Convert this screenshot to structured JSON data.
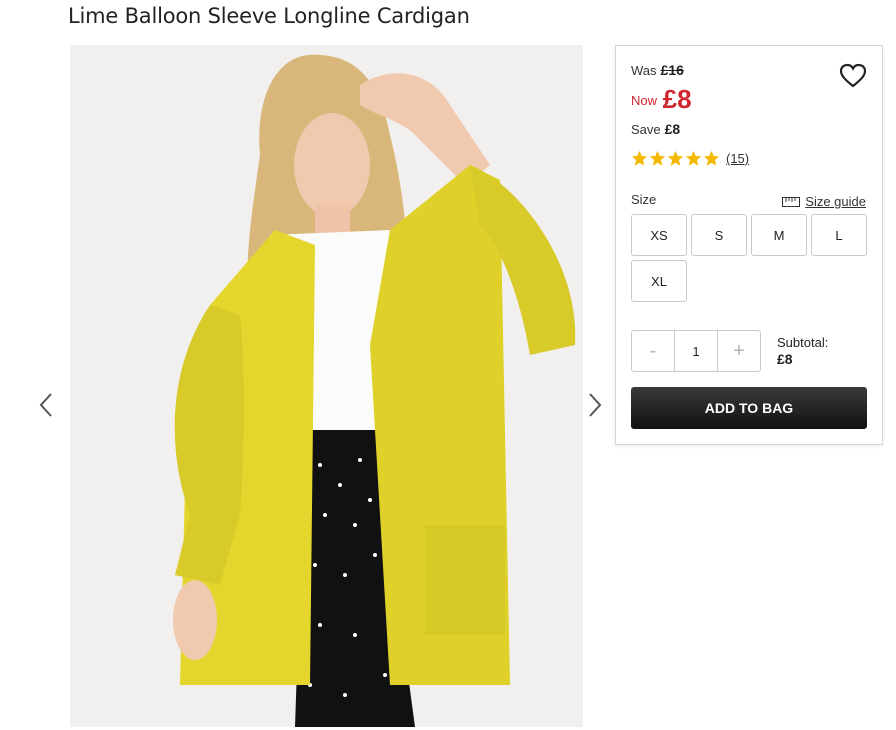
{
  "product": {
    "title": "Lime Balloon Sleeve Longline Cardigan"
  },
  "gallery": {
    "image_desc": "product-photo",
    "prev_icon": "chevron-left-icon",
    "next_icon": "chevron-right-icon",
    "colors": {
      "cardigan": "#e4d62c",
      "skirt": "#111111"
    }
  },
  "price": {
    "was_label": "Was",
    "was_value": "£16",
    "now_label": "Now",
    "now_value": "£8",
    "save_label": "Save",
    "save_value": "£8",
    "accent_color": "#d0262d"
  },
  "rating": {
    "stars": 5,
    "count": "(15)",
    "star_color": "#f5b800"
  },
  "size": {
    "label": "Size",
    "guide_label": "Size guide",
    "options": [
      "XS",
      "S",
      "M",
      "L",
      "XL"
    ]
  },
  "quantity": {
    "minus": "-",
    "value": "1",
    "plus": "+"
  },
  "subtotal": {
    "label": "Subtotal:",
    "value": "£8"
  },
  "cta": {
    "add_to_bag": "ADD TO BAG"
  }
}
